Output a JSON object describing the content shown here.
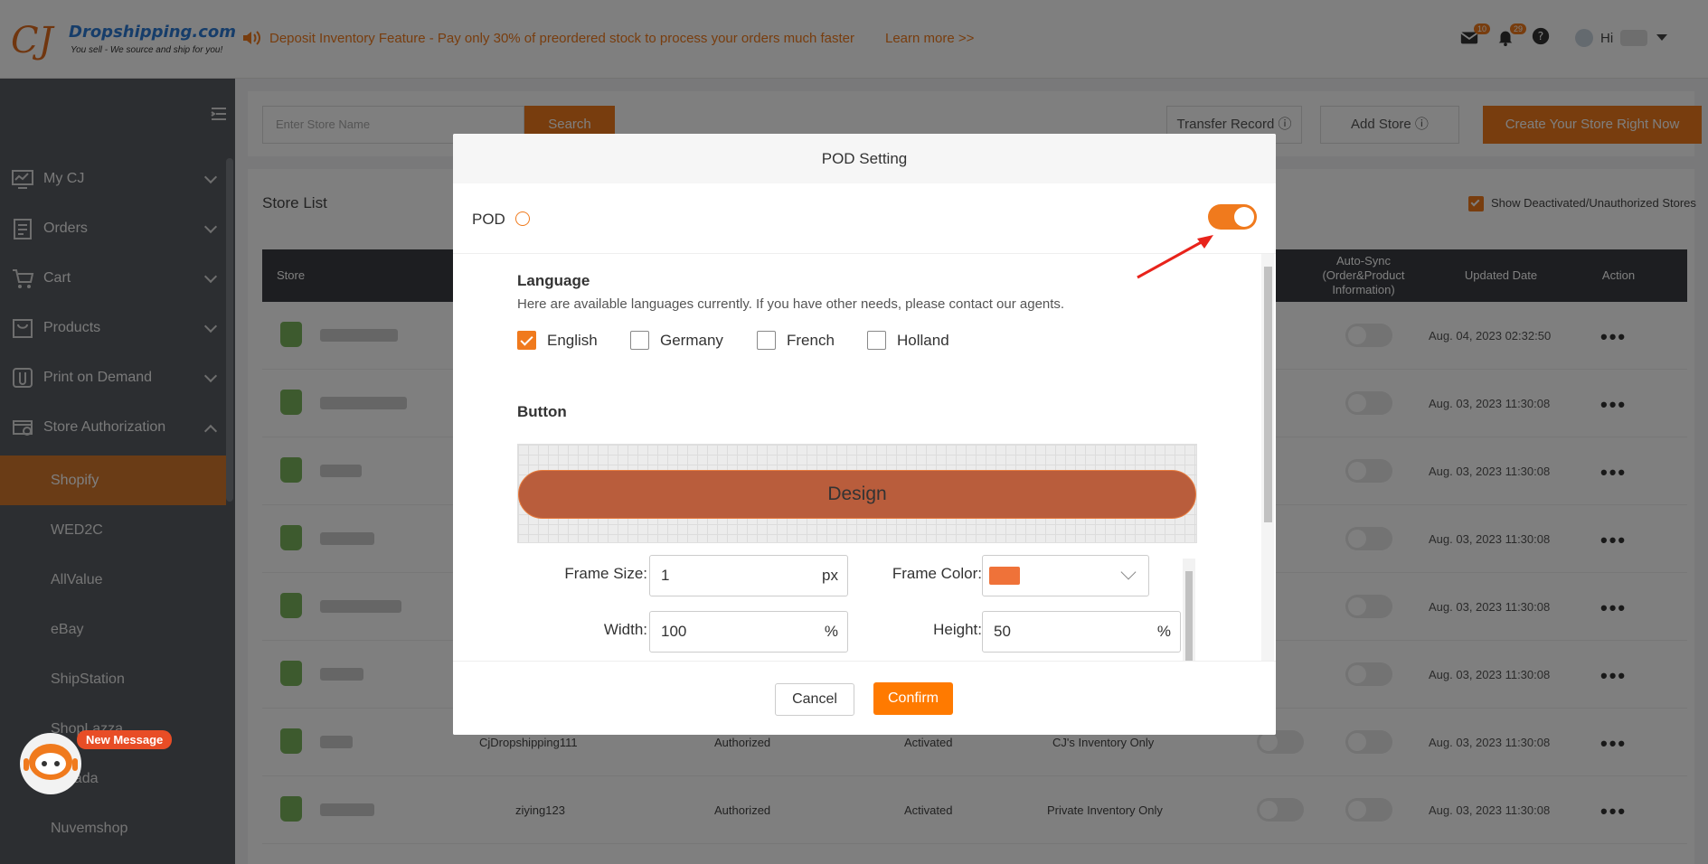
{
  "header": {
    "logo_mark": "CJ",
    "logo_name": "Dropshipping.com",
    "logo_tagline": "You sell - We source and ship for you!",
    "notice": "Deposit Inventory Feature - Pay only 30% of preordered stock to process your orders much faster",
    "notice_link": "Learn more >>",
    "mail_badge": "10",
    "bell_badge": "29",
    "greeting": "Hi"
  },
  "sidebar": {
    "items": [
      {
        "label": "My CJ"
      },
      {
        "label": "Orders"
      },
      {
        "label": "Cart"
      },
      {
        "label": "Products"
      },
      {
        "label": "Print on Demand"
      },
      {
        "label": "Store Authorization"
      }
    ],
    "sub_items": [
      "Shopify",
      "WED2C",
      "AllValue",
      "eBay",
      "ShipStation",
      "ShopLazza",
      "Lazada",
      "Nuvemshop"
    ]
  },
  "toolbar": {
    "search_placeholder": "Enter Store Name",
    "search_label": "Search",
    "transfer_label": "Transfer Record",
    "add_store_label": "Add Store",
    "create_label": "Create Your Store Right Now"
  },
  "store_list": {
    "title": "Store List",
    "show_deactivated": "Show Deactivated/Unauthorized Stores",
    "columns": {
      "store": "Store",
      "auto_sync": "Auto-Sync (Order&Product Information)",
      "updated": "Updated Date",
      "action": "Action"
    },
    "rows": [
      {
        "date": "Aug. 04, 2023 02:32:50"
      },
      {
        "date": "Aug. 03, 2023 11:30:08"
      },
      {
        "date": "Aug. 03, 2023 11:30:08"
      },
      {
        "date": "Aug. 03, 2023 11:30:08"
      },
      {
        "date": "Aug. 03, 2023 11:30:08"
      },
      {
        "date": "Aug. 03, 2023 11:30:08"
      },
      {
        "date": "Aug. 03, 2023 11:30:08",
        "name": "CjDropshipping111",
        "status": "Authorized",
        "state": "Activated",
        "inventory": "CJ's Inventory Only"
      },
      {
        "date": "Aug. 03, 2023 11:30:08",
        "name": "ziying123",
        "status": "Authorized",
        "state": "Activated",
        "inventory": "Private Inventory Only"
      }
    ],
    "actions_label": "•••"
  },
  "modal": {
    "title": "POD Setting",
    "pod_label": "POD",
    "pod_enabled": true,
    "language_title": "Language",
    "language_desc": "Here are available languages currently. If you have other needs, please contact our agents.",
    "languages": [
      {
        "label": "English",
        "checked": true
      },
      {
        "label": "Germany",
        "checked": false
      },
      {
        "label": "French",
        "checked": false
      },
      {
        "label": "Holland",
        "checked": false
      }
    ],
    "button_title": "Button",
    "design_label": "Design",
    "frame_size_label": "Frame Size:",
    "frame_size_value": "1",
    "frame_size_unit": "px",
    "frame_color_label": "Frame Color:",
    "frame_color": "#ef7239",
    "width_label": "Width:",
    "width_value": "100",
    "width_unit": "%",
    "height_label": "Height:",
    "height_value": "50",
    "height_unit": "%",
    "cancel_label": "Cancel",
    "confirm_label": "Confirm"
  },
  "chat": {
    "new_message": "New Message"
  },
  "colors": {
    "accent": "#f07a1d",
    "sidebar": "#585c62",
    "design_fill": "#b95d3c"
  }
}
